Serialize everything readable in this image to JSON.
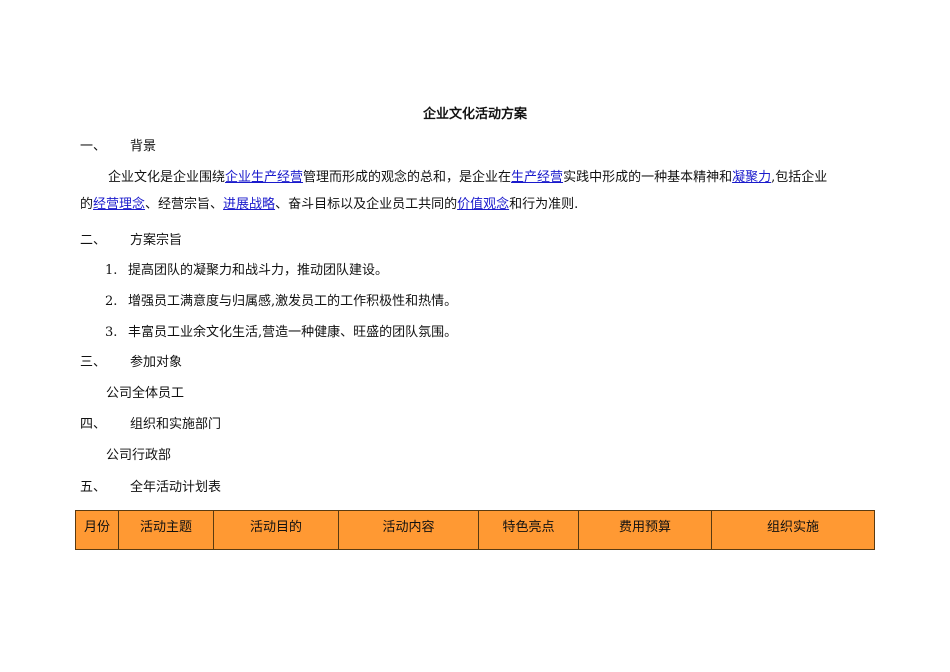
{
  "title": "企业文化活动方案",
  "sections": [
    {
      "num": "一、",
      "label": "背景"
    },
    {
      "num": "二、",
      "label": "方案宗旨"
    },
    {
      "num": "三、",
      "label": "参加对象"
    },
    {
      "num": "四、",
      "label": "组织和实施部门"
    },
    {
      "num": "五、",
      "label": "全年活动计划表"
    }
  ],
  "background": {
    "line1": [
      {
        "text": "企业文化是企业围绕",
        "link": false
      },
      {
        "text": "企业生产经营",
        "link": true
      },
      {
        "text": "管理而形成的观念的总和，是企业在",
        "link": false
      },
      {
        "text": "生产经营",
        "link": true
      },
      {
        "text": "实践中形成的一种基本精神和",
        "link": false
      },
      {
        "text": "凝聚力",
        "link": true
      },
      {
        "text": ",包括企业",
        "link": false
      }
    ],
    "line2": [
      {
        "text": "的",
        "link": false
      },
      {
        "text": "经营理念",
        "link": true
      },
      {
        "text": "、经营宗旨、",
        "link": false
      },
      {
        "text": "进展战略",
        "link": true
      },
      {
        "text": "、奋斗目标以及企业员工共同的",
        "link": false
      },
      {
        "text": "价值观念",
        "link": true
      },
      {
        "text": "和行为准则.",
        "link": false
      }
    ]
  },
  "aims": [
    {
      "num": "1.",
      "text": "提高团队的凝聚力和战斗力，推动团队建设。"
    },
    {
      "num": "2.",
      "text": "增强员工满意度与归属感,激发员工的工作积极性和热情。"
    },
    {
      "num": "3.",
      "text": "丰富员工业余文化生活,营造一种健康、旺盛的团队氛围。"
    }
  ],
  "participants": "公司全体员工",
  "department": "公司行政部",
  "table": {
    "headers": [
      "月份",
      "活动主题",
      "活动目的",
      "活动内容",
      "特色亮点",
      "费用预算",
      "组织实施"
    ],
    "header_bg": "#ff9933"
  }
}
